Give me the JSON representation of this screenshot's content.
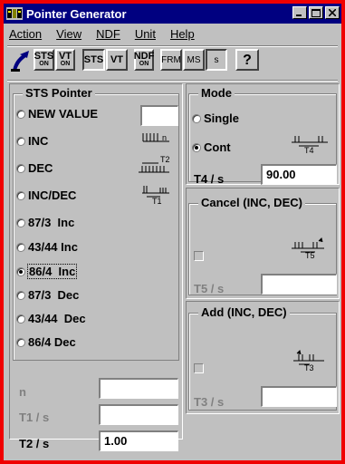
{
  "window": {
    "title": "Pointer Generator"
  },
  "menu": [
    "Action",
    "View",
    "NDF",
    "Unit",
    "Help"
  ],
  "toolbar": {
    "sts_on": {
      "top": "STS",
      "sub": "ON"
    },
    "vt_on": {
      "top": "VT",
      "sub": "ON"
    },
    "sts": "STS",
    "vt": "VT",
    "ndf_on": {
      "top": "NDF",
      "sub": "ON"
    },
    "frm": "FRM",
    "ms": "MS",
    "s": "s",
    "help": "?"
  },
  "sts_pointer": {
    "label": "STS Pointer",
    "options": [
      "NEW VALUE",
      "INC",
      "DEC",
      "INC/DEC",
      "87/3  Inc",
      "43/44 Inc",
      "86/4  Inc",
      "87/3  Dec",
      "43/44  Dec",
      "86/4  Dec"
    ],
    "selected": "86/4  Inc",
    "new_value": "",
    "glyph_labels": {
      "inc": "n",
      "dec": "T2",
      "incdec": "T1"
    },
    "n_label": "n",
    "n_value": "",
    "t1_label": "T1 / s",
    "t1_value": "",
    "t2_label": "T2 / s",
    "t2_value": "1.00"
  },
  "mode": {
    "label": "Mode",
    "single": "Single",
    "cont": "Cont",
    "selected": "Cont",
    "glyph_label": "T4",
    "t4_label": "T4 / s",
    "t4_value": "90.00"
  },
  "cancel": {
    "label": "Cancel (INC, DEC)",
    "glyph_label": "T5",
    "t5_label": "T5 / s",
    "t5_value": "",
    "checked": false
  },
  "add": {
    "label": "Add (INC, DEC)",
    "glyph_label": "T3",
    "t3_label": "T3 / s",
    "t3_value": "",
    "checked": false
  },
  "colors": {
    "title_bar": "#000080",
    "window_frame": "#f00000",
    "face": "#c0c0c0",
    "disabled_text": "#808080"
  }
}
